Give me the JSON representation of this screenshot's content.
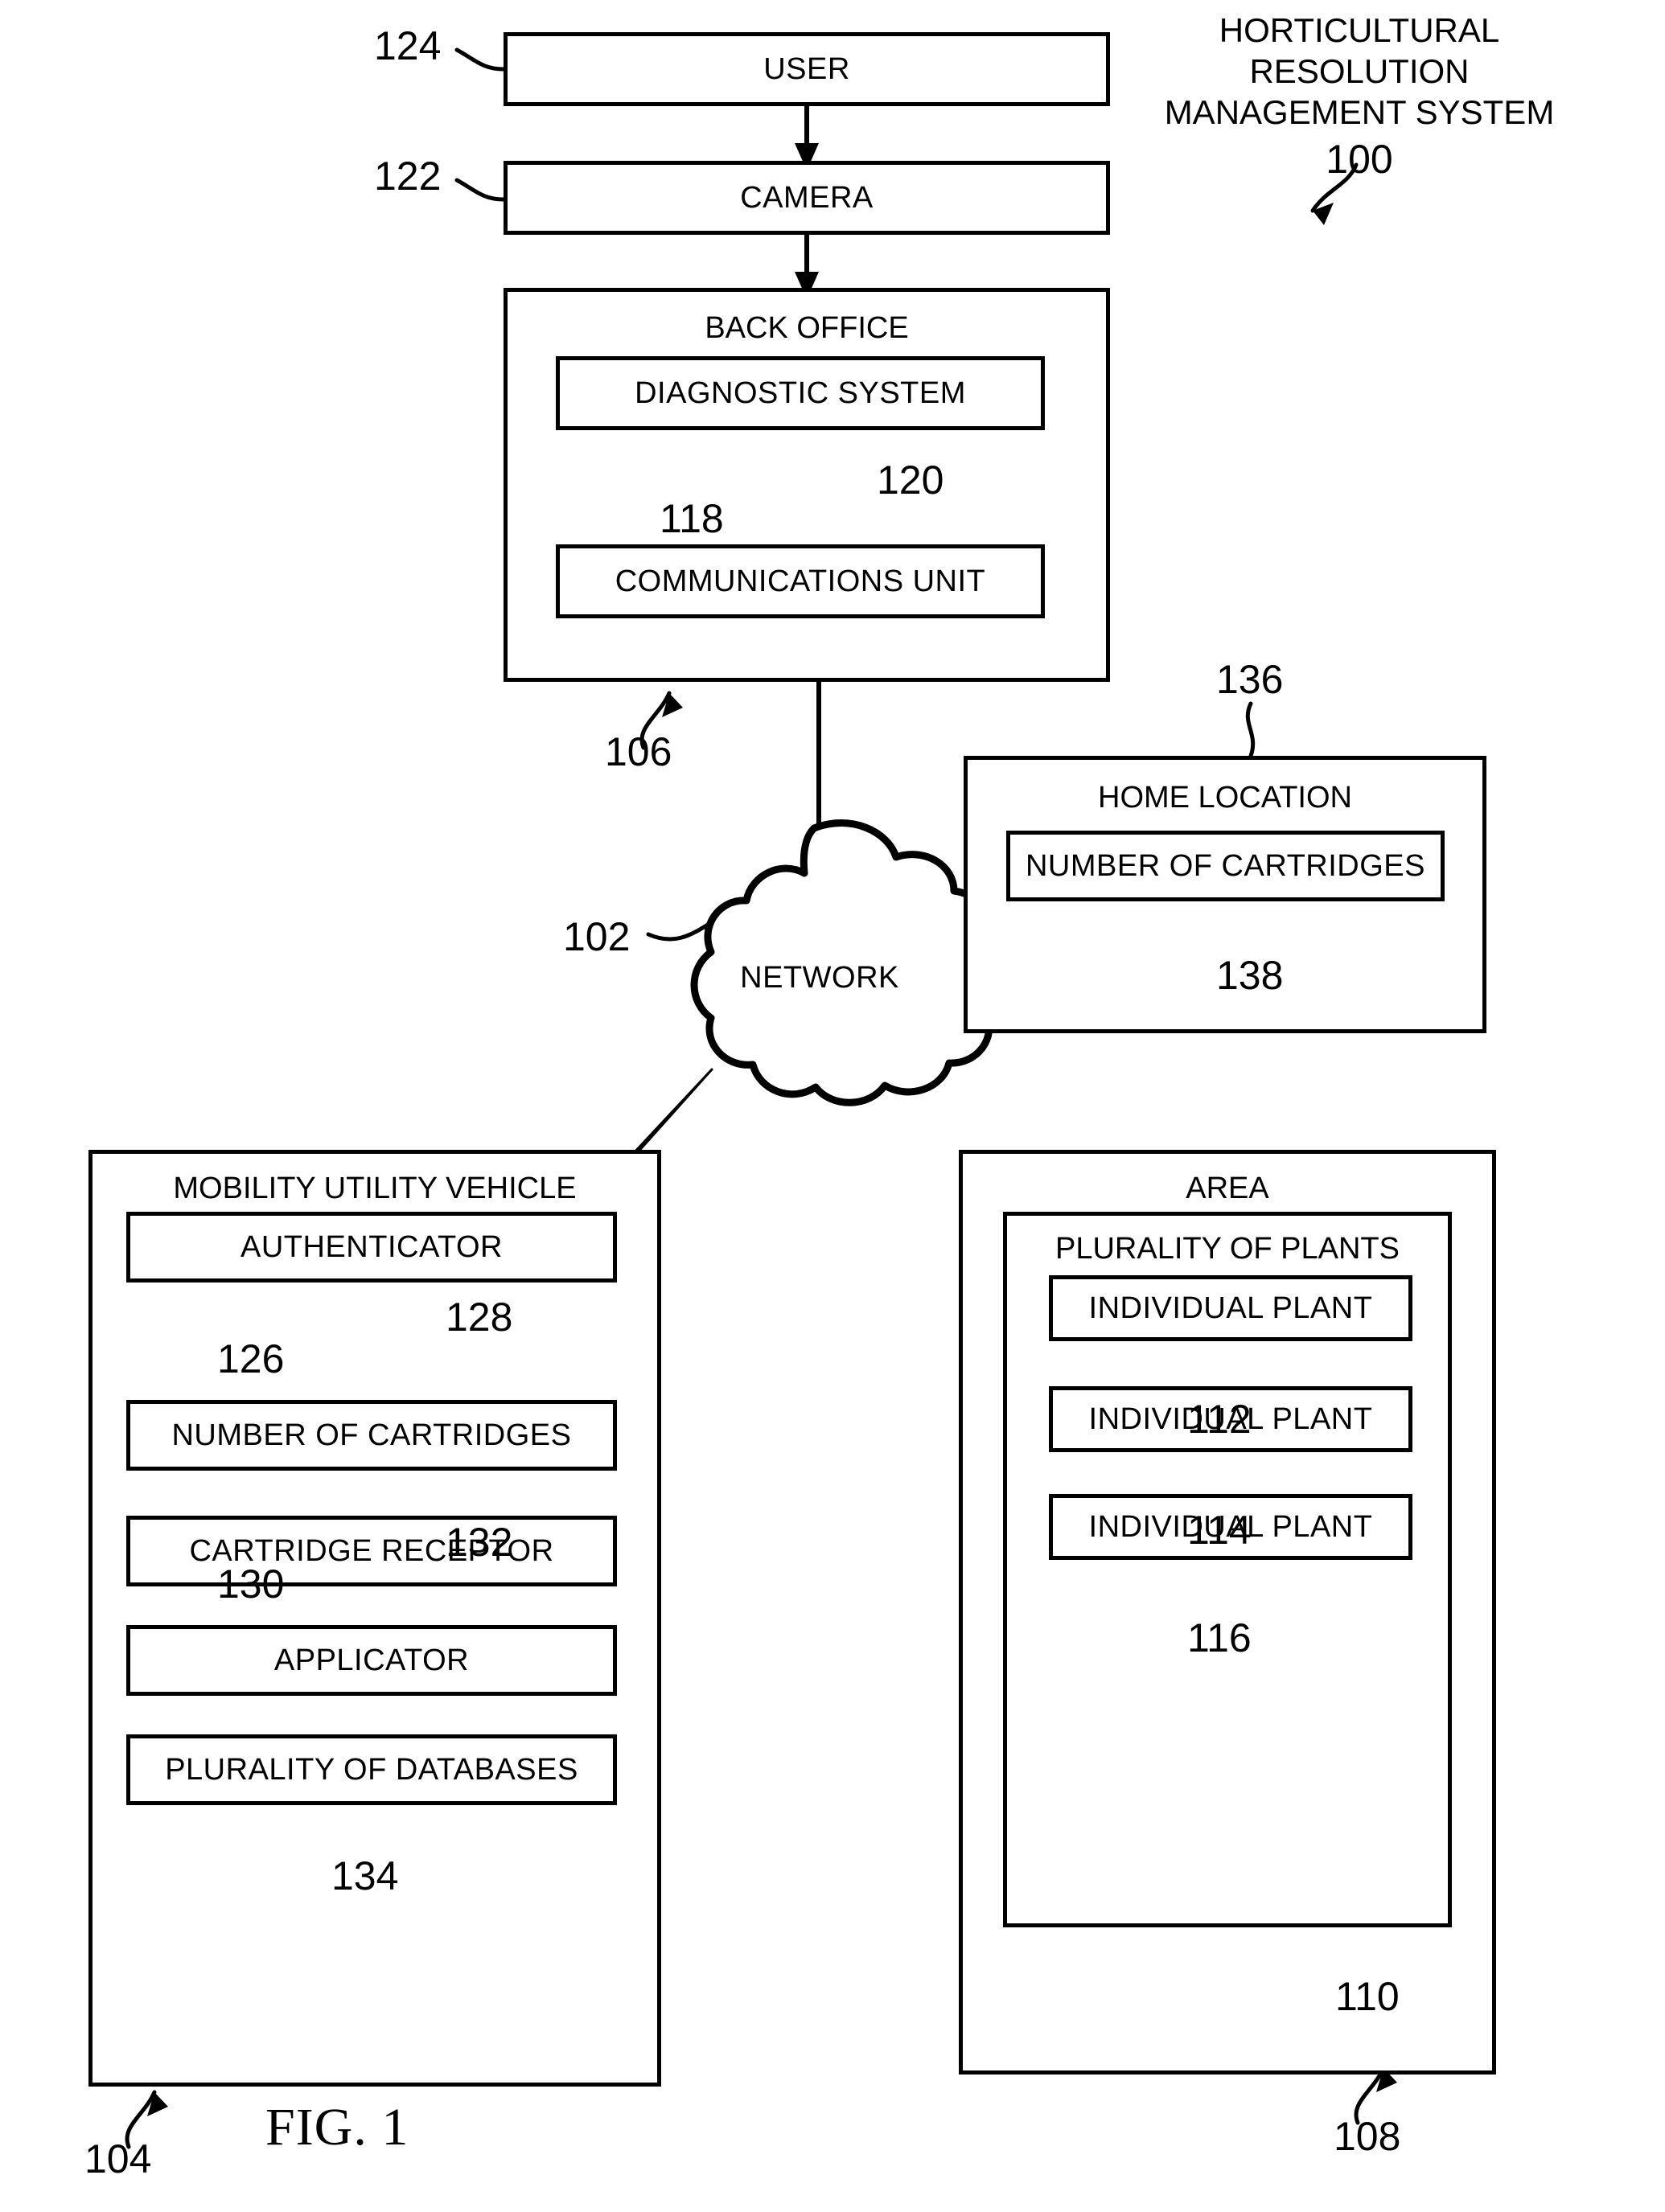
{
  "figure": {
    "caption": "FIG. 1",
    "system_title_lines": [
      "HORTICULTURAL",
      "RESOLUTION",
      "MANAGEMENT SYSTEM"
    ],
    "system_numeral": "100"
  },
  "nodes": {
    "user": {
      "label": "USER",
      "numeral": "124"
    },
    "camera": {
      "label": "CAMERA",
      "numeral": "122"
    },
    "back_office": {
      "label": "BACK OFFICE",
      "numeral": "106",
      "children": [
        {
          "label": "DIAGNOSTIC SYSTEM",
          "numeral": "118"
        },
        {
          "label": "COMMUNICATIONS UNIT",
          "numeral": "120"
        }
      ]
    },
    "network": {
      "label": "NETWORK",
      "numeral": "102"
    },
    "home_location": {
      "label": "HOME LOCATION",
      "numeral": "136",
      "children": [
        {
          "label": "NUMBER OF CARTRIDGES",
          "numeral": "138"
        }
      ]
    },
    "mobility_utility_vehicle": {
      "label": "MOBILITY UTILITY VEHICLE",
      "numeral": "104",
      "children": [
        {
          "label": "AUTHENTICATOR",
          "numeral": "126"
        },
        {
          "label": "NUMBER OF CARTRIDGES",
          "numeral": "128"
        },
        {
          "label": "CARTRIDGE RECEPTOR",
          "numeral": "130"
        },
        {
          "label": "APPLICATOR",
          "numeral": "132"
        },
        {
          "label": "PLURALITY OF DATABASES",
          "numeral": "134"
        }
      ]
    },
    "area": {
      "label": "AREA",
      "numeral": "108",
      "plurality": {
        "label": "PLURALITY OF PLANTS",
        "numeral": "110"
      },
      "plants": [
        {
          "label": "INDIVIDUAL PLANT",
          "numeral": "112"
        },
        {
          "label": "INDIVIDUAL PLANT",
          "numeral": "114"
        },
        {
          "label": "INDIVIDUAL PLANT",
          "numeral": "116"
        }
      ]
    }
  },
  "colors": {
    "ink": "#000000",
    "paper": "#ffffff"
  }
}
